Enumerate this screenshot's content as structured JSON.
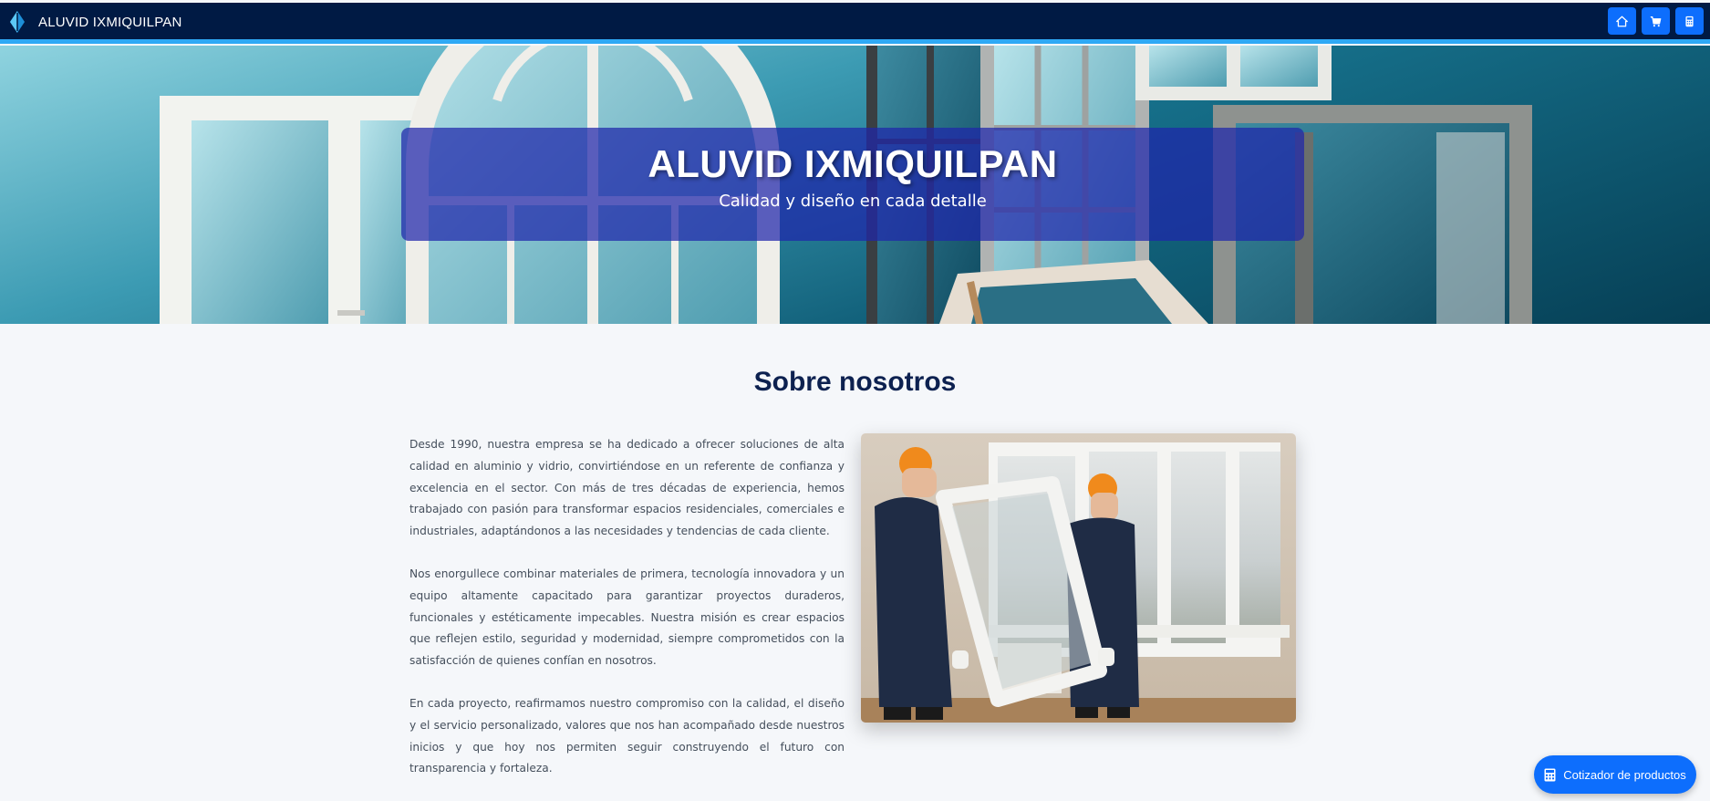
{
  "navbar": {
    "brand_name": "ALUVID IXMIQUILPAN",
    "icons": [
      "home-icon",
      "cart-icon",
      "calculator-icon"
    ]
  },
  "hero": {
    "title": "ALUVID IXMIQUILPAN",
    "subtitle": "Calidad y diseño en cada detalle"
  },
  "about": {
    "heading": "Sobre nosotros",
    "paragraphs": [
      "Desde 1990, nuestra empresa se ha dedicado a ofrecer soluciones de alta calidad en aluminio y vidrio, convirtiéndose en un referente de confianza y excelencia en el sector. Con más de tres décadas de experiencia, hemos trabajado con pasión para transformar espacios residenciales, comerciales e industriales, adaptándonos a las necesidades y tendencias de cada cliente.",
      "Nos enorgullece combinar materiales de primera, tecnología innovadora y un equipo altamente capacitado para garantizar proyectos duraderos, funcionales y estéticamente impecables. Nuestra misión es crear espacios que reflejen estilo, seguridad y modernidad, siempre comprometidos con la satisfacción de quienes confían en nosotros.",
      "En cada proyecto, reafirmamos nuestro compromiso con la calidad, el diseño y el servicio personalizado, valores que nos han acompañado desde nuestros inicios y que hoy nos permiten seguir construyendo el futuro con transparencia y fortaleza."
    ]
  },
  "floating_button": {
    "label": "Cotizador de productos",
    "icon": "calculator-icon"
  },
  "colors": {
    "navbar_bg": "#001a44",
    "navbar_accent": "#2ea9f5",
    "button_blue": "#0d6efd",
    "hero_overlay": "#1e26aa",
    "heading": "#0d2150"
  }
}
